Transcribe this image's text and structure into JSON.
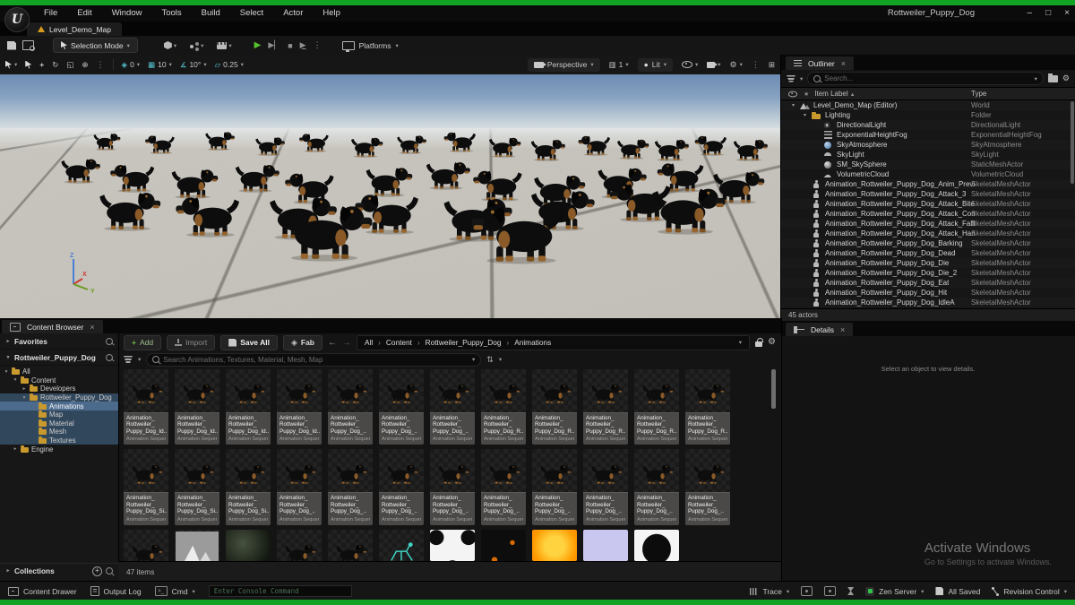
{
  "window": {
    "title": "Rottweiler_Puppy_Dog",
    "logo": "U",
    "controls": [
      {
        "name": "minimize",
        "glyph": "–"
      },
      {
        "name": "maximize",
        "glyph": "□"
      },
      {
        "name": "close",
        "glyph": "×"
      }
    ]
  },
  "menubar": {
    "items": [
      "File",
      "Edit",
      "Window",
      "Tools",
      "Build",
      "Select",
      "Actor",
      "Help"
    ]
  },
  "level_tab": {
    "label": "Level_Demo_Map"
  },
  "toolbar": {
    "selection_mode": "Selection Mode",
    "platforms": "Platforms"
  },
  "viewport": {
    "snap_pct": "0",
    "grid_snap": "10",
    "rotation_snap": "10°",
    "scale_snap": "0.25",
    "perspective": "Perspective",
    "screen_percent": "1",
    "lit": "Lit",
    "axis": {
      "x": "X",
      "y": "Y",
      "z": "Z"
    },
    "dogs": [
      [
        118,
        85,
        22,
        1
      ],
      [
        180,
        89,
        24,
        -1
      ],
      [
        244,
        85,
        24,
        1
      ],
      [
        300,
        91,
        24,
        1
      ],
      [
        352,
        87,
        24,
        -1
      ],
      [
        408,
        93,
        26,
        1
      ],
      [
        458,
        89,
        24,
        1
      ],
      [
        515,
        87,
        26,
        -1
      ],
      [
        562,
        93,
        26,
        1
      ],
      [
        610,
        97,
        28,
        1
      ],
      [
        665,
        91,
        26,
        -1
      ],
      [
        705,
        95,
        26,
        1
      ],
      [
        748,
        97,
        28,
        1
      ],
      [
        795,
        91,
        26,
        -1
      ],
      [
        836,
        97,
        28,
        1
      ],
      [
        88,
        122,
        32,
        1
      ],
      [
        150,
        132,
        36,
        -1
      ],
      [
        215,
        139,
        38,
        1
      ],
      [
        285,
        132,
        36,
        1
      ],
      [
        348,
        145,
        40,
        -1
      ],
      [
        432,
        137,
        38,
        1
      ],
      [
        498,
        129,
        36,
        1
      ],
      [
        558,
        142,
        40,
        -1
      ],
      [
        622,
        149,
        42,
        1
      ],
      [
        692,
        139,
        40,
        1
      ],
      [
        762,
        132,
        38,
        -1
      ],
      [
        822,
        145,
        42,
        1
      ],
      [
        142,
        175,
        50,
        1
      ],
      [
        235,
        182,
        52,
        -1
      ],
      [
        335,
        185,
        55,
        1
      ],
      [
        435,
        179,
        52,
        -1
      ],
      [
        530,
        187,
        56,
        1
      ],
      [
        625,
        175,
        52,
        1
      ],
      [
        718,
        165,
        50,
        -1
      ],
      [
        362,
        209,
        72,
        1
      ],
      [
        582,
        212,
        75,
        -1
      ],
      [
        765,
        179,
        60,
        1
      ]
    ]
  },
  "outliner": {
    "tab": "Outliner",
    "search_placeholder": "Search...",
    "col_item": "Item Label",
    "col_sort": "▲",
    "col_type": "Type",
    "rows": [
      {
        "label": "Level_Demo_Map (Editor)",
        "type": "World",
        "depth": 0,
        "icon": "world",
        "arrow": true
      },
      {
        "label": "Lighting",
        "type": "Folder",
        "depth": 1,
        "icon": "folder",
        "arrow": true
      },
      {
        "label": "DirectionalLight",
        "type": "DirectionalLight",
        "depth": 2,
        "icon": "sun"
      },
      {
        "label": "ExponentialHeightFog",
        "type": "ExponentialHeightFog",
        "depth": 2,
        "icon": "fog"
      },
      {
        "label": "SkyAtmosphere",
        "type": "SkyAtmosphere",
        "depth": 2,
        "icon": "atmo"
      },
      {
        "label": "SkyLight",
        "type": "SkyLight",
        "depth": 2,
        "icon": "skylight"
      },
      {
        "label": "SM_SkySphere",
        "type": "StaticMeshActor",
        "depth": 2,
        "icon": "sphere"
      },
      {
        "label": "VolumetricCloud",
        "type": "VolumetricCloud",
        "depth": 2,
        "icon": "cloud"
      },
      {
        "label": "Animation_Rottweiler_Puppy_Dog_Anim_Preview",
        "type": "SkeletalMeshActor",
        "depth": 1,
        "icon": "person"
      },
      {
        "label": "Animation_Rottweiler_Puppy_Dog_Attack_3",
        "type": "SkeletalMeshActor",
        "depth": 1,
        "icon": "person"
      },
      {
        "label": "Animation_Rottweiler_Puppy_Dog_Attack_Bite",
        "type": "SkeletalMeshActor",
        "depth": 1,
        "icon": "person"
      },
      {
        "label": "Animation_Rottweiler_Puppy_Dog_Attack_Combat",
        "type": "SkeletalMeshActor",
        "depth": 1,
        "icon": "person"
      },
      {
        "label": "Animation_Rottweiler_Puppy_Dog_Attack_Fallback",
        "type": "SkeletalMeshActor",
        "depth": 1,
        "icon": "person"
      },
      {
        "label": "Animation_Rottweiler_Puppy_Dog_Attack_Hand",
        "type": "SkeletalMeshActor",
        "depth": 1,
        "icon": "person"
      },
      {
        "label": "Animation_Rottweiler_Puppy_Dog_Barking",
        "type": "SkeletalMeshActor",
        "depth": 1,
        "icon": "person"
      },
      {
        "label": "Animation_Rottweiler_Puppy_Dog_Dead",
        "type": "SkeletalMeshActor",
        "depth": 1,
        "icon": "person"
      },
      {
        "label": "Animation_Rottweiler_Puppy_Dog_Die",
        "type": "SkeletalMeshActor",
        "depth": 1,
        "icon": "person"
      },
      {
        "label": "Animation_Rottweiler_Puppy_Dog_Die_2",
        "type": "SkeletalMeshActor",
        "depth": 1,
        "icon": "person"
      },
      {
        "label": "Animation_Rottweiler_Puppy_Dog_Eat",
        "type": "SkeletalMeshActor",
        "depth": 1,
        "icon": "person"
      },
      {
        "label": "Animation_Rottweiler_Puppy_Dog_Hit",
        "type": "SkeletalMeshActor",
        "depth": 1,
        "icon": "person"
      },
      {
        "label": "Animation_Rottweiler_Puppy_Dog_IdleA",
        "type": "SkeletalMeshActor",
        "depth": 1,
        "icon": "person"
      }
    ],
    "footer": "45 actors"
  },
  "details": {
    "tab": "Details",
    "empty_text": "Select an object to view details."
  },
  "watermark": {
    "line1": "Activate Windows",
    "line2": "Go to Settings to activate Windows."
  },
  "content_browser": {
    "tab": "Content Browser",
    "favorites": "Favorites",
    "root": "Rottweiler_Puppy_Dog",
    "collections": "Collections",
    "add": "Add",
    "import": "Import",
    "save_all": "Save All",
    "fab": "Fab",
    "breadcrumb": [
      "All",
      "Content",
      "Rottweiler_Puppy_Dog",
      "Animations"
    ],
    "search_placeholder": "Search Animations, Textures, Material, Mesh, Map",
    "items_count": "47 items",
    "subtitle": "Animation Sequence",
    "tree": [
      {
        "label": "All",
        "depth": 0,
        "arrow": "open"
      },
      {
        "label": "Content",
        "depth": 1,
        "arrow": "open"
      },
      {
        "label": "Developers",
        "depth": 2,
        "arrow": "closed"
      },
      {
        "label": "Rottweiler_Puppy_Dog",
        "depth": 2,
        "arrow": "open",
        "sel": "block"
      },
      {
        "label": "Animations",
        "depth": 3,
        "sel": "active"
      },
      {
        "label": "Map",
        "depth": 3,
        "sel": "block"
      },
      {
        "label": "Material",
        "depth": 3,
        "sel": "block"
      },
      {
        "label": "Mesh",
        "depth": 3,
        "sel": "block"
      },
      {
        "label": "Textures",
        "depth": 3,
        "sel": "block"
      },
      {
        "label": "Engine",
        "depth": 1,
        "arrow": "closed"
      }
    ],
    "row1": [
      "Animation_\nRottweiler_\nPuppy_Dog_Id..",
      "Animation_\nRottweiler_\nPuppy_Dog_Id..",
      "Animation_\nRottweiler_\nPuppy_Dog_Id..",
      "Animation_\nRottweiler_\nPuppy_Dog_Id..",
      "Animation_\nRottweiler_\nPuppy_Dog_..",
      "Animation_\nRottweiler_\nPuppy_Dog_..",
      "Animation_\nRottweiler_\nPuppy_Dog_..",
      "Animation_\nRottweiler_\nPuppy_Dog_R..",
      "Animation_\nRottweiler_\nPuppy_Dog_R..",
      "Animation_\nRottweiler_\nPuppy_Dog_R..",
      "Animation_\nRottweiler_\nPuppy_Dog_R..",
      "Animation_\nRottweiler_\nPuppy_Dog_R.."
    ],
    "row2": [
      "Animation_\nRottweiler_\nPuppy_Dog_Si..",
      "Animation_\nRottweiler_\nPuppy_Dog_Si..",
      "Animation_\nRottweiler_\nPuppy_Dog_Si..",
      "Animation_\nRottweiler_\nPuppy_Dog_..",
      "Animation_\nRottweiler_\nPuppy_Dog_..",
      "Animation_\nRottweiler_\nPuppy_Dog_..",
      "Animation_\nRottweiler_\nPuppy_Dog_..",
      "Animation_\nRottweiler_\nPuppy_Dog_..",
      "Animation_\nRottweiler_\nPuppy_Dog_..",
      "Animation_\nRottweiler_\nPuppy_Dog_..",
      "Animation_\nRottweiler_\nPuppy_Dog_..",
      "Animation_\nRottweiler_\nPuppy_Dog_.."
    ],
    "row3": [
      "dog",
      "mountain",
      "sphere",
      "dog",
      "dog",
      "skeleton",
      "white",
      "dark",
      "orange",
      "lav",
      "bw"
    ]
  },
  "statusbar": {
    "content_drawer": "Content Drawer",
    "output_log": "Output Log",
    "cmd": "Cmd",
    "console_placeholder": "Enter Console Command",
    "trace": "Trace",
    "zen": "Zen Server",
    "all_saved": "All Saved",
    "revision": "Revision Control"
  }
}
